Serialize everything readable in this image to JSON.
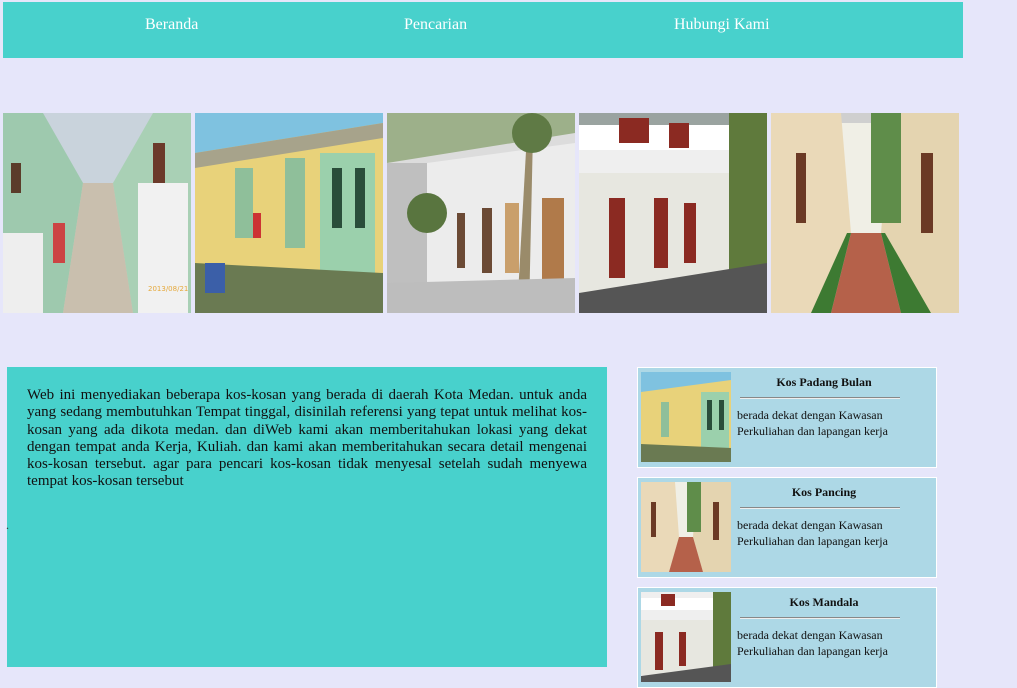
{
  "nav": {
    "items": [
      {
        "label": "Beranda"
      },
      {
        "label": "Pencarian"
      },
      {
        "label": "Hubungi Kami"
      }
    ]
  },
  "gallery": {
    "images": [
      {
        "icon": "corridor-photo"
      },
      {
        "icon": "rooms-photo"
      },
      {
        "icon": "building-photo"
      },
      {
        "icon": "balcony-photo"
      },
      {
        "icon": "garden-path-photo"
      }
    ]
  },
  "main": {
    "description": "Web ini menyediakan beberapa kos-kosan yang berada di daerah Kota Medan. untuk anda yang sedang membutuhkan Tempat tinggal, disinilah referensi yang tepat untuk melihat kos-kosan yang ada dikota medan. dan diWeb kami akan memberitahukan lokasi yang dekat dengan tempat anda Kerja, Kuliah. dan kami akan memberitahukan secara detail mengenai kos-kosan tersebut. agar para pencari kos-kosan tidak menyesal setelah sudah menyewa tempat kos-kosan tersebut",
    "stray_mark": "."
  },
  "listings": [
    {
      "title": "Kos Padang Bulan",
      "desc": "berada dekat dengan Kawasan Perkuliahan dan lapangan kerja"
    },
    {
      "title": "Kos Pancing",
      "desc": "berada dekat dengan Kawasan Perkuliahan dan lapangan kerja"
    },
    {
      "title": "Kos Mandala",
      "desc": "berada dekat dengan Kawasan Perkuliahan dan lapangan kerja"
    }
  ],
  "colors": {
    "page_bg": "#e6e6fa",
    "accent_turquoise": "#48d1cc",
    "card_bg": "#add8e6",
    "nav_text": "#ffffff"
  }
}
